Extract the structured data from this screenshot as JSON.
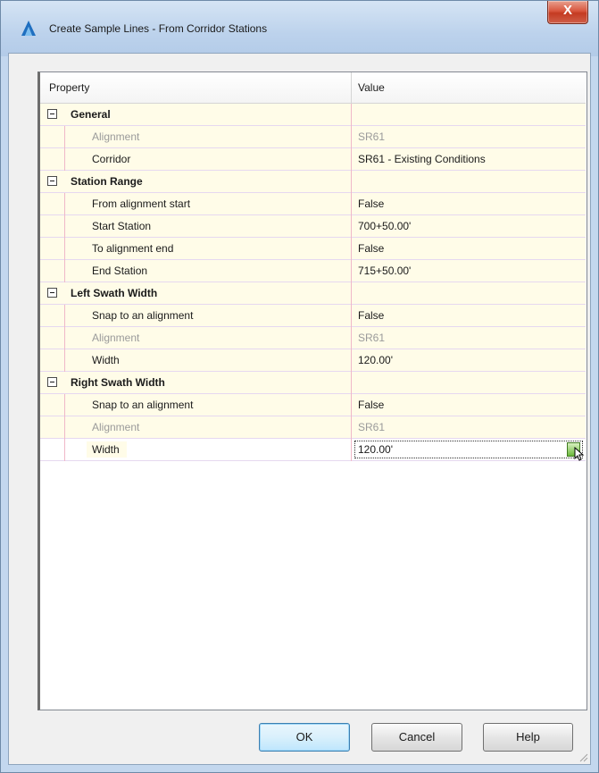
{
  "window": {
    "title": "Create Sample Lines - From Corridor Stations",
    "close_glyph": "X"
  },
  "grid": {
    "header": {
      "property": "Property",
      "value": "Value"
    },
    "rows": [
      {
        "type": "category",
        "label": "General"
      },
      {
        "type": "prop",
        "label": "Alignment",
        "value": "SR61",
        "disabled": true
      },
      {
        "type": "prop",
        "label": "Corridor",
        "value": "SR61 - Existing Conditions"
      },
      {
        "type": "category",
        "label": "Station Range"
      },
      {
        "type": "prop",
        "label": "From alignment start",
        "value": "False"
      },
      {
        "type": "prop",
        "label": "Start Station",
        "value": "700+50.00'"
      },
      {
        "type": "prop",
        "label": "To alignment end",
        "value": "False"
      },
      {
        "type": "prop",
        "label": "End Station",
        "value": "715+50.00'"
      },
      {
        "type": "category",
        "label": "Left Swath Width"
      },
      {
        "type": "prop",
        "label": "Snap to an alignment",
        "value": "False"
      },
      {
        "type": "prop",
        "label": "Alignment",
        "value": "SR61",
        "disabled": true
      },
      {
        "type": "prop",
        "label": "Width",
        "value": "120.00'"
      },
      {
        "type": "category",
        "label": "Right Swath Width"
      },
      {
        "type": "prop",
        "label": "Snap to an alignment",
        "value": "False"
      },
      {
        "type": "prop",
        "label": "Alignment",
        "value": "SR61",
        "disabled": true
      },
      {
        "type": "prop",
        "label": "Width",
        "value": "120.00'",
        "selected": true
      }
    ]
  },
  "buttons": {
    "ok": "OK",
    "cancel": "Cancel",
    "help": "Help"
  },
  "colors": {
    "accent": "#3c7fb1",
    "row_bg": "#fffce8",
    "close_red": "#c43b22"
  }
}
